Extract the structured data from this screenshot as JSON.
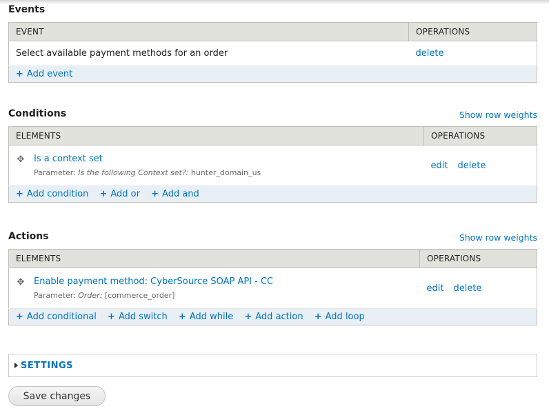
{
  "events": {
    "title": "Events",
    "col_event": "EVENT",
    "col_ops": "OPERATIONS",
    "rows": [
      {
        "label": "Select available payment methods for an order",
        "delete": "delete"
      }
    ],
    "add_event": "Add event"
  },
  "conditions": {
    "title": "Conditions",
    "row_weights": "Show row weights",
    "col_elements": "ELEMENTS",
    "col_ops": "OPERATIONS",
    "rows": [
      {
        "label": "Is a context set",
        "param_prefix": "Parameter:",
        "param_key": "Is the following Context set?:",
        "param_value": "hunter_domain_us",
        "edit": "edit",
        "delete": "delete"
      }
    ],
    "add_condition": "Add condition",
    "add_or": "Add or",
    "add_and": "Add and"
  },
  "actions": {
    "title": "Actions",
    "row_weights": "Show row weights",
    "col_elements": "ELEMENTS",
    "col_ops": "OPERATIONS",
    "rows": [
      {
        "label": "Enable payment method: CyberSource SOAP API - CC",
        "param_prefix": "Parameter:",
        "param_key": "Order:",
        "param_value": "[commerce_order]",
        "edit": "edit",
        "delete": "delete"
      }
    ],
    "add_conditional": "Add conditional",
    "add_switch": "Add switch",
    "add_while": "Add while",
    "add_action": "Add action",
    "add_loop": "Add loop"
  },
  "settings": {
    "label": "SETTINGS"
  },
  "save_button": "Save changes",
  "colors": {
    "link": "#0074bd",
    "header_bg": "#e1e2dc",
    "add_row_bg": "#e8eff5"
  }
}
